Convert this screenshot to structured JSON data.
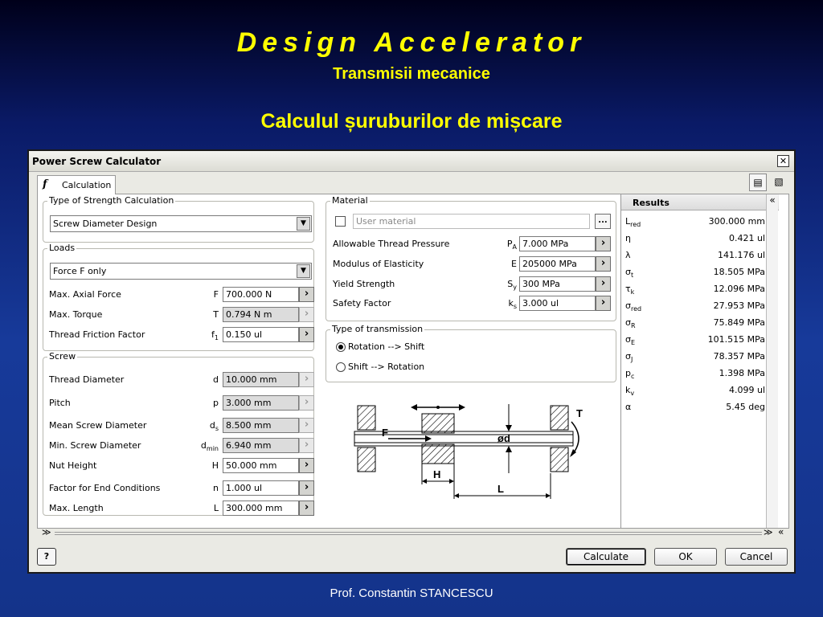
{
  "slide": {
    "title": "Design Accelerator",
    "subtitle": "Transmisii mecanice",
    "heading": "Calculul șuruburilor de mișcare",
    "footer": "Prof. Constantin STANCESCU"
  },
  "window": {
    "title": "Power Screw Calculator",
    "close": "✕",
    "tab": "Calculation",
    "tab_icon": "f",
    "icons": {
      "report": "▤",
      "copy": "▧"
    }
  },
  "strength": {
    "title": "Type of Strength Calculation",
    "value": "Screw Diameter Design"
  },
  "loads": {
    "title": "Loads",
    "value": "Force F only",
    "rows": [
      {
        "label": "Max. Axial Force",
        "sym": "F",
        "sub": "",
        "value": "700.000 N"
      },
      {
        "label": "Max. Torque",
        "sym": "T",
        "sub": "",
        "value": "0.794 N m"
      },
      {
        "label": "Thread Friction Factor",
        "sym": "f",
        "sub": "1",
        "value": "0.150 ul"
      }
    ]
  },
  "screw": {
    "title": "Screw",
    "rows": [
      {
        "label": "Thread Diameter",
        "sym": "d",
        "sub": "",
        "value": "10.000 mm"
      },
      {
        "label": "Pitch",
        "sym": "p",
        "sub": "",
        "value": "3.000 mm"
      },
      {
        "label": "Mean Screw Diameter",
        "sym": "d",
        "sub": "s",
        "value": "8.500 mm"
      },
      {
        "label": "Min. Screw Diameter",
        "sym": "d",
        "sub": "min",
        "value": "6.940 mm"
      },
      {
        "label": "Nut Height",
        "sym": "H",
        "sub": "",
        "value": "50.000 mm"
      },
      {
        "label": "Factor for End Conditions",
        "sym": "n",
        "sub": "",
        "value": "1.000 ul"
      },
      {
        "label": "Max. Length",
        "sym": "L",
        "sub": "",
        "value": "300.000 mm"
      }
    ]
  },
  "material": {
    "title": "Material",
    "user": "User material",
    "browse": "...",
    "rows": [
      {
        "label": "Allowable Thread Pressure",
        "sym": "P",
        "sub": "A",
        "value": "7.000 MPa"
      },
      {
        "label": "Modulus of Elasticity",
        "sym": "E",
        "sub": "",
        "value": "205000 MPa"
      },
      {
        "label": "Yield Strength",
        "sym": "S",
        "sub": "y",
        "value": "300 MPa"
      },
      {
        "label": "Safety Factor",
        "sym": "k",
        "sub": "s",
        "value": "3.000 ul"
      }
    ]
  },
  "transmission": {
    "title": "Type of transmission",
    "options": [
      "Rotation --> Shift",
      "Shift --> Rotation"
    ]
  },
  "diagram": {
    "F": "F",
    "d": "ød",
    "H": "H",
    "L": "L",
    "T": "T"
  },
  "results": {
    "title": "Results",
    "rows": [
      {
        "sym": "L",
        "sub": "red",
        "value": "300.000 mm"
      },
      {
        "sym": "η",
        "sub": "",
        "value": "0.421 ul"
      },
      {
        "sym": "λ",
        "sub": "",
        "value": "141.176 ul"
      },
      {
        "sym": "σ",
        "sub": "t",
        "value": "18.505 MPa"
      },
      {
        "sym": "τ",
        "sub": "k",
        "value": "12.096 MPa"
      },
      {
        "sym": "σ",
        "sub": "red",
        "value": "27.953 MPa"
      },
      {
        "sym": "σ",
        "sub": "R",
        "value": "75.849 MPa"
      },
      {
        "sym": "σ",
        "sub": "E",
        "value": "101.515 MPa"
      },
      {
        "sym": "σ",
        "sub": "J",
        "value": "78.357 MPa"
      },
      {
        "sym": "p",
        "sub": "c",
        "value": "1.398 MPa"
      },
      {
        "sym": "k",
        "sub": "v",
        "value": "4.099 ul"
      },
      {
        "sym": "α",
        "sub": "",
        "value": "5.45 deg"
      }
    ]
  },
  "buttons": {
    "help": "?",
    "calculate": "Calculate",
    "ok": "OK",
    "cancel": "Cancel"
  },
  "chevrons": {
    "collapse": "«",
    "expand_down": "»",
    "down": "≫"
  }
}
